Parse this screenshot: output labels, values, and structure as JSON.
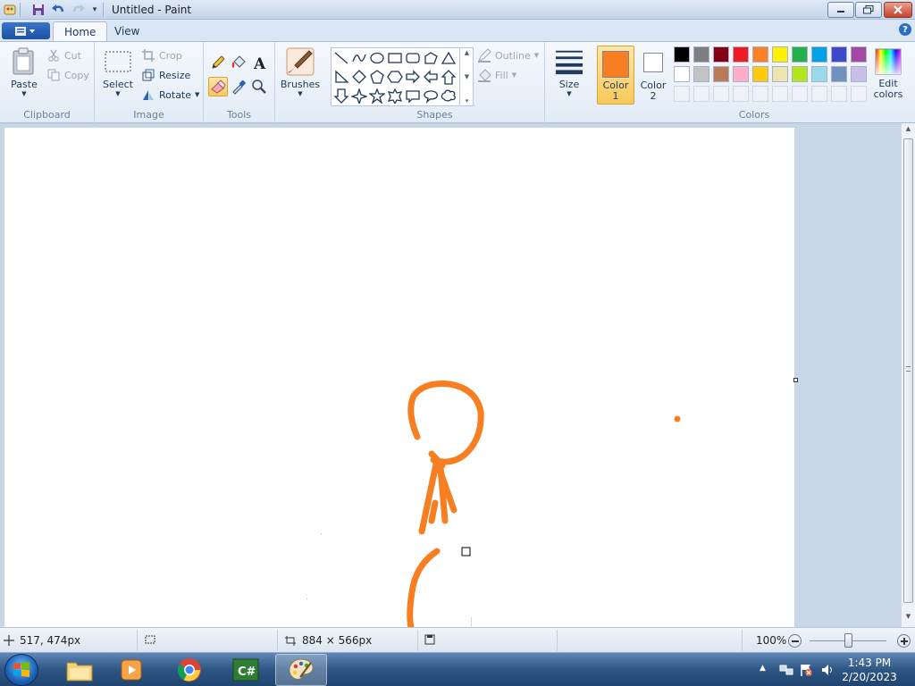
{
  "window": {
    "title": "Untitled - Paint"
  },
  "ribbon": {
    "tabs": [
      {
        "label": "Home",
        "active": true
      },
      {
        "label": "View",
        "active": false
      }
    ],
    "clipboard": {
      "group_label": "Clipboard",
      "paste": "Paste",
      "cut": "Cut",
      "copy": "Copy"
    },
    "image": {
      "group_label": "Image",
      "select": "Select",
      "crop": "Crop",
      "resize": "Resize",
      "rotate": "Rotate"
    },
    "tools": {
      "group_label": "Tools"
    },
    "brushes": {
      "label": "Brushes"
    },
    "shapes": {
      "group_label": "Shapes",
      "outline": "Outline",
      "fill": "Fill"
    },
    "size": {
      "label": "Size"
    },
    "colors": {
      "group_label": "Colors",
      "color1_label_line1": "Color",
      "color1_label_line2": "1",
      "color2_label_line1": "Color",
      "color2_label_line2": "2",
      "edit_line1": "Edit",
      "edit_line2": "colors",
      "color1_value": "#f77f22",
      "color2_value": "#ffffff",
      "palette_row1": [
        "#000000",
        "#7f7f7f",
        "#880015",
        "#ed1c24",
        "#ff7f27",
        "#fff200",
        "#22b14c",
        "#00a2e8",
        "#3f48cc",
        "#a349a4"
      ],
      "palette_row2": [
        "#ffffff",
        "#c3c3c3",
        "#b97a57",
        "#ffaec9",
        "#ffc90e",
        "#efe4b0",
        "#b5e61d",
        "#99d9ea",
        "#7092be",
        "#c8bfe7"
      ]
    }
  },
  "canvas": {
    "stroke_color": "#f77f22"
  },
  "status": {
    "cursor_pos": "517, 474px",
    "image_size": "884 × 566px",
    "zoom": "100%"
  },
  "taskbar": {
    "time": "1:43 PM",
    "date": "2/20/2023"
  }
}
